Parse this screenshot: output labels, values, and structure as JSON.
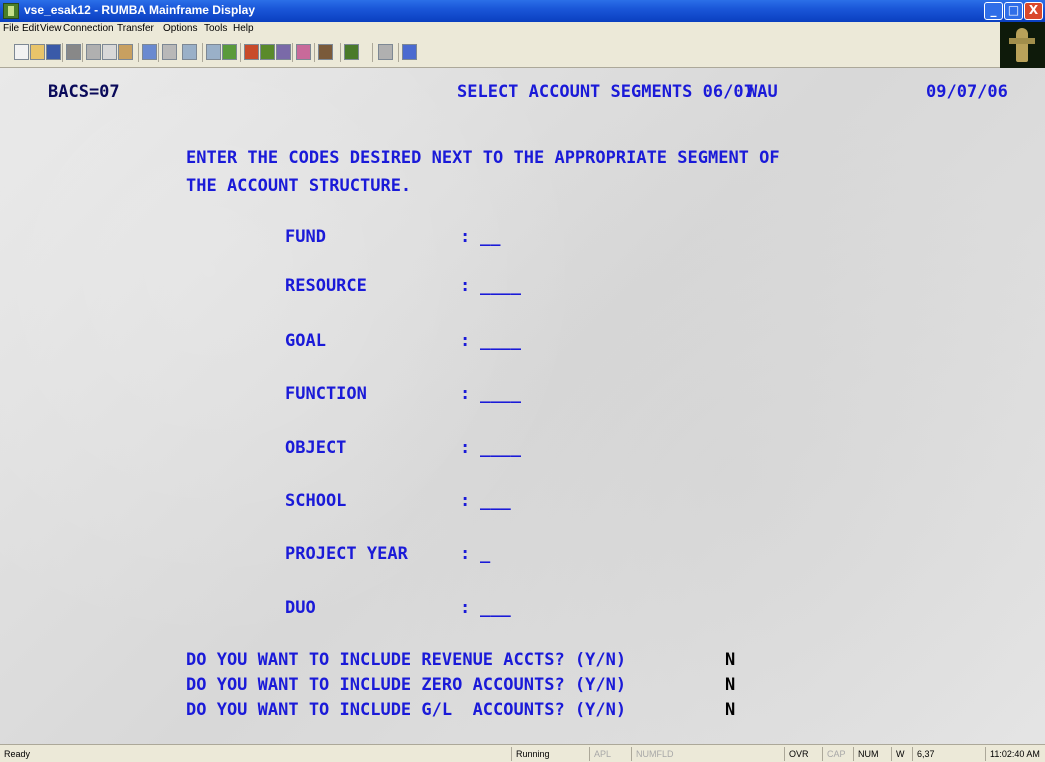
{
  "window": {
    "title": "vse_esak12 - RUMBA Mainframe Display",
    "controls": {
      "minimize": "_",
      "maximize": "□",
      "close": "X"
    }
  },
  "menu": [
    "File",
    "Edit",
    "View",
    "Connection",
    "Transfer",
    "Options",
    "Tools",
    "Help"
  ],
  "toolbar": {
    "icons": [
      "new-icon",
      "open-icon",
      "save-icon",
      "print-icon",
      "cut-icon",
      "copy-icon",
      "paste-icon",
      "undo-icon",
      "transfer-icon",
      "send-icon",
      "receive-icon",
      "macro-icon",
      "record-icon",
      "play-icon",
      "settings-icon",
      "color-icon",
      "keyboard-icon",
      "display-icon",
      "hotspot-icon",
      "help-icon"
    ]
  },
  "terminal": {
    "screen_id": "BACS=07",
    "header": "SELECT ACCOUNT SEGMENTS 06/07",
    "user": "WAU",
    "date": "09/07/06",
    "instructions_line1": "ENTER THE CODES DESIRED NEXT TO THE APPROPRIATE SEGMENT OF",
    "instructions_line2": "THE ACCOUNT STRUCTURE.",
    "fields": [
      {
        "label": "FUND",
        "sep": ":",
        "value": "__"
      },
      {
        "label": "RESOURCE",
        "sep": ":",
        "value": "____"
      },
      {
        "label": "GOAL",
        "sep": ":",
        "value": "____"
      },
      {
        "label": "FUNCTION",
        "sep": ":",
        "value": "____"
      },
      {
        "label": "OBJECT",
        "sep": ":",
        "value": "____"
      },
      {
        "label": "SCHOOL",
        "sep": ":",
        "value": "___"
      },
      {
        "label": "PROJECT YEAR",
        "sep": ":",
        "value": "_"
      },
      {
        "label": "DUO",
        "sep": ":",
        "value": "___"
      }
    ],
    "questions": [
      {
        "text": "DO YOU WANT TO INCLUDE REVENUE ACCTS? (Y/N)",
        "answer": "N"
      },
      {
        "text": "DO YOU WANT TO INCLUDE ZERO ACCOUNTS? (Y/N)",
        "answer": "N"
      },
      {
        "text": "DO YOU WANT TO INCLUDE G/L  ACCOUNTS? (Y/N)",
        "answer": "N"
      }
    ]
  },
  "statusbar": {
    "ready": "Ready",
    "running": "Running",
    "apl": "APL",
    "numfld": "NUMFLD",
    "ovr": "OVR",
    "cap": "CAP",
    "num": "NUM",
    "w": "W",
    "cursor": "6,37",
    "time": "11:02:40 AM"
  }
}
